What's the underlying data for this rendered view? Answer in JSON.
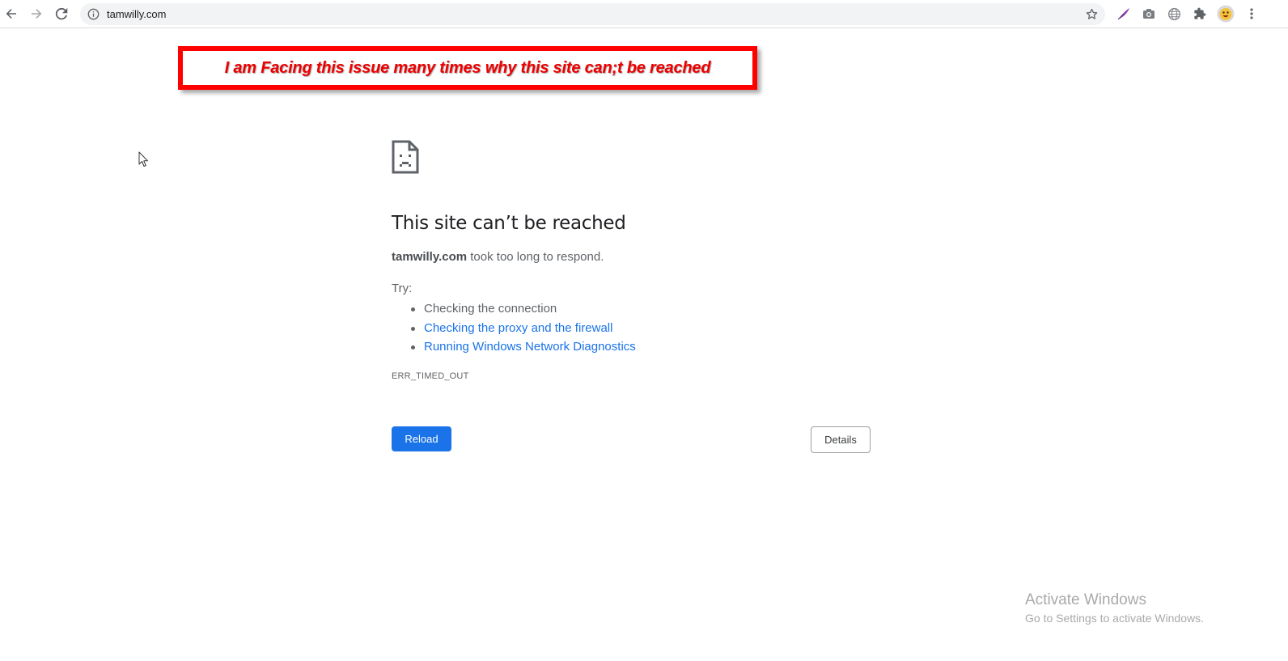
{
  "browser": {
    "url": "tamwilly.com",
    "icons": {
      "back": "arrow-left-icon",
      "forward": "arrow-right-icon",
      "reload": "reload-icon",
      "info": "info-icon",
      "star": "star-icon",
      "extension_feather": "feather-icon",
      "extension_camera": "camera-icon",
      "extension_globe": "globe-icon",
      "extensions": "puzzle-icon",
      "profile": "avatar-icon",
      "menu": "kebab-menu-icon"
    }
  },
  "annotation": {
    "text": "I am Facing this issue many times why this site can;t be reached",
    "color": "#ff0000"
  },
  "error_page": {
    "icon": "sad-page-icon",
    "title": "This site can’t be reached",
    "host": "tamwilly.com",
    "message": " took too long to respond.",
    "try_label": "Try:",
    "suggestions": [
      {
        "text": "Checking the connection",
        "is_link": false
      },
      {
        "text": "Checking the proxy and the firewall",
        "is_link": true
      },
      {
        "text": "Running Windows Network Diagnostics",
        "is_link": true
      }
    ],
    "error_code": "ERR_TIMED_OUT",
    "reload_label": "Reload",
    "details_label": "Details",
    "accent_color": "#1a73e8"
  },
  "watermark": {
    "title": "Activate Windows",
    "subtitle": "Go to Settings to activate Windows."
  }
}
